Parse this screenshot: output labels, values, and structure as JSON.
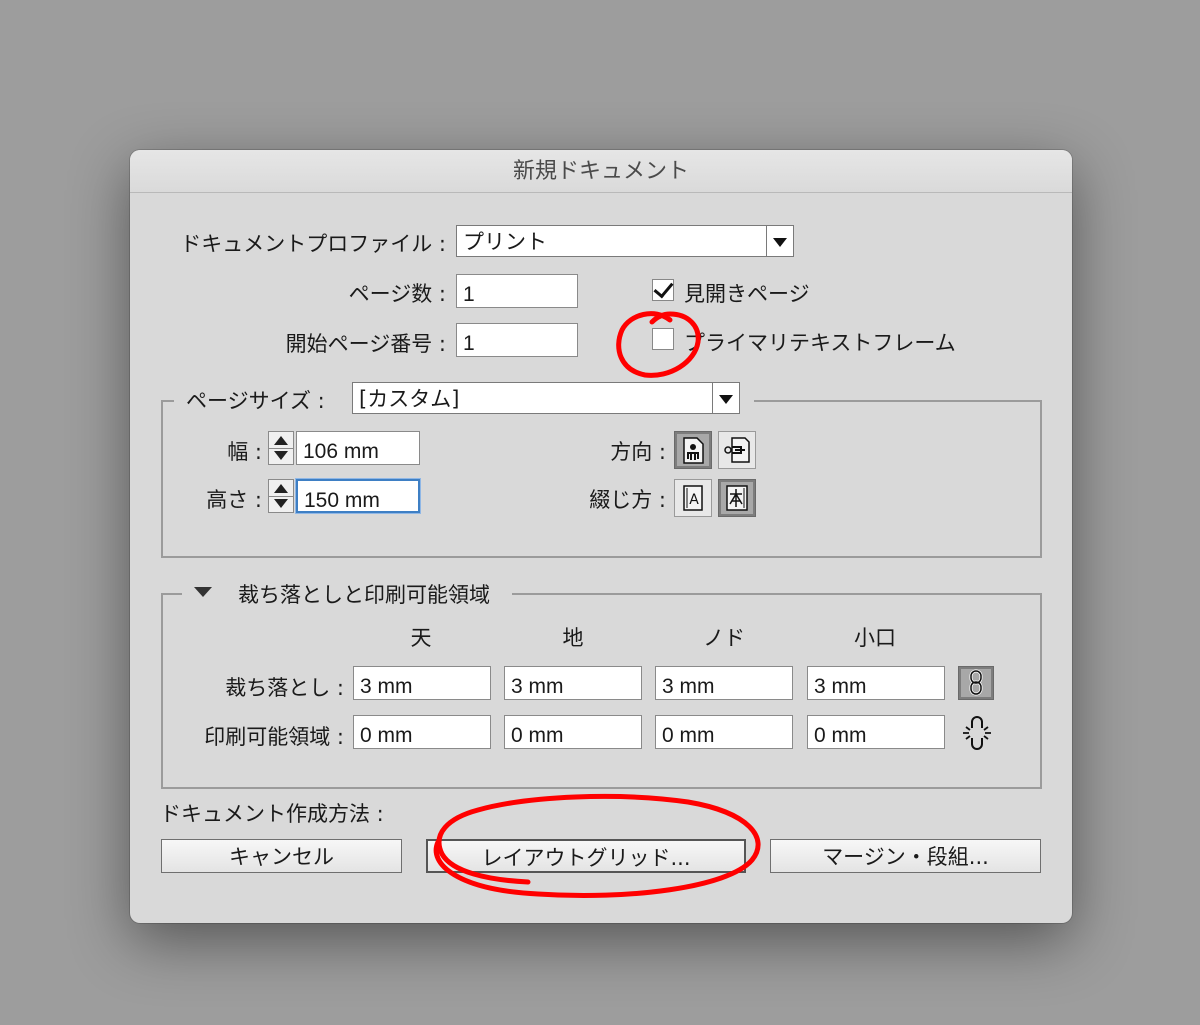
{
  "dialog": {
    "title": "新規ドキュメント"
  },
  "profile": {
    "label": "ドキュメントプロファイル :",
    "value": "プリント"
  },
  "pages": {
    "label": "ページ数 :",
    "value": "1"
  },
  "start_page": {
    "label": "開始ページ番号 :",
    "value": "1"
  },
  "facing_pages": {
    "label": "見開きページ",
    "checked": true
  },
  "primary_text_frame": {
    "label": "プライマリテキストフレーム",
    "checked": false
  },
  "page_size": {
    "label": "ページサイズ :",
    "value": "[カスタム]",
    "width_label": "幅 :",
    "width_value": "106 mm",
    "height_label": "高さ :",
    "height_value": "150 mm",
    "orientation_label": "方向 :",
    "binding_label": "綴じ方 :"
  },
  "bleed": {
    "section_label": "裁ち落としと印刷可能領域",
    "columns": [
      "天",
      "地",
      "ノド",
      "小口"
    ],
    "bleed_label": "裁ち落とし :",
    "bleed_values": [
      "3 mm",
      "3 mm",
      "3 mm",
      "3 mm"
    ],
    "slug_label": "印刷可能領域 :",
    "slug_values": [
      "0 mm",
      "0 mm",
      "0 mm",
      "0 mm"
    ]
  },
  "creation": {
    "label": "ドキュメント作成方法 :",
    "cancel": "キャンセル",
    "layout_grid": "レイアウトグリッド...",
    "margins_columns": "マージン・段組..."
  },
  "colors": {
    "annotation": "#ff0000",
    "focus": "#3e7fc4"
  }
}
